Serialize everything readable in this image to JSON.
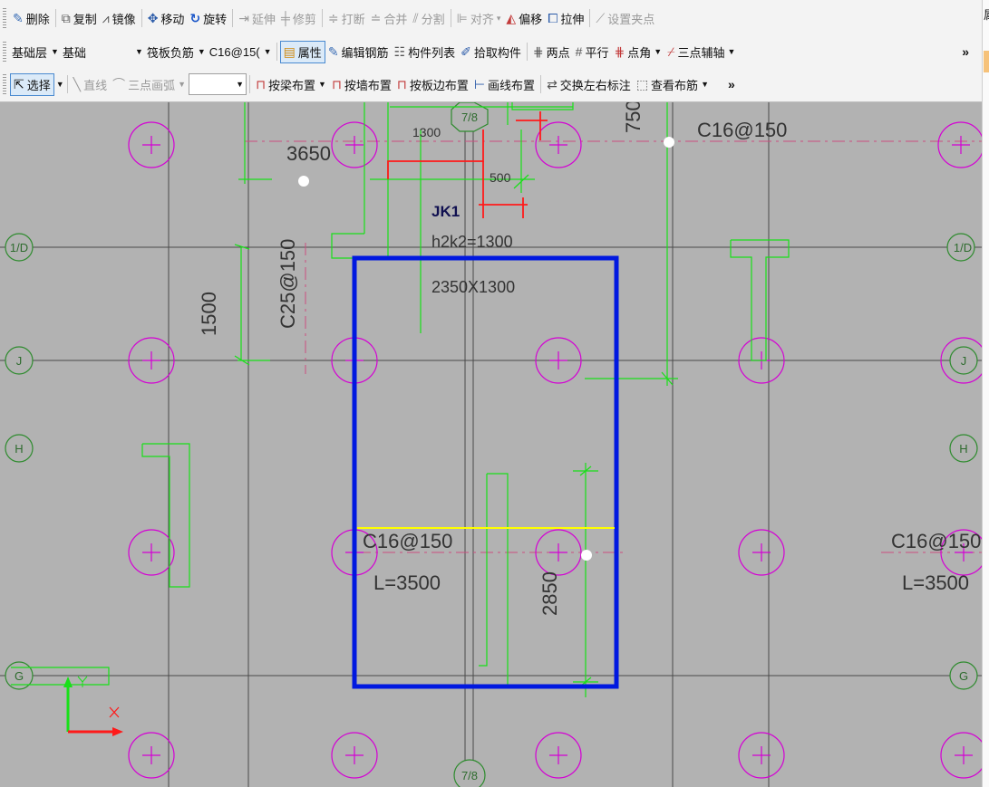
{
  "toolbar1": {
    "delete": "删除",
    "copy": "复制",
    "mirror": "镜像",
    "move": "移动",
    "rotate": "旋转",
    "extend": "延伸",
    "trim": "修剪",
    "break": "打断",
    "merge": "合并",
    "split": "分割",
    "align": "对齐",
    "offset": "偏移",
    "stretch": "拉伸",
    "set_grip": "设置夹点"
  },
  "toolbar2": {
    "layer": "基础层",
    "category": "基础",
    "component_type": "筏板负筋",
    "component": "C16@15(",
    "properties": "属性",
    "edit_rebar": "编辑钢筋",
    "component_list": "构件列表",
    "pick": "拾取构件",
    "two_points": "两点",
    "parallel": "平行",
    "point_angle": "点角",
    "three_point_axis": "三点辅轴"
  },
  "toolbar3": {
    "select": "选择",
    "line": "直线",
    "arc": "三点画弧",
    "by_beam": "按梁布置",
    "by_wall": "按墙布置",
    "by_slab_edge": "按板边布置",
    "by_line": "画线布置",
    "swap_labels": "交换左右标注",
    "view_rebar": "查看布筋"
  },
  "more_glyph": "»",
  "right_panel_text": "属",
  "colors": {
    "canvas_bg": "#b2b2b2",
    "axis": "#4a4a4a",
    "grid_bubble": "#2e8b2e",
    "column_circle": "#d400d4",
    "rebar_green": "#18e018",
    "rebar_red": "#ff1a1a",
    "selection_blue": "#0018e0",
    "highlight_yellow": "#ffff00",
    "dash_line": "#cc4d80",
    "label_dark": "#333333",
    "label_blue": "#101050"
  },
  "drawing": {
    "axis_bubbles": {
      "top": "7/8",
      "bottom": "7/8",
      "row_1D": "1/D",
      "row_J": "J",
      "row_H": "H",
      "row_G": "G"
    },
    "labels": {
      "dim_1300": "1300",
      "dim_3650": "3650",
      "dim_500": "500",
      "dim_750": "750",
      "rebar_top_right": "C16@150",
      "jk_name": "JK1",
      "jk_height": "h2k2=1300",
      "jk_size": "2350X1300",
      "dim_1500": "1500",
      "rebar_c25": "C25@150",
      "rebar_center": "C16@150",
      "len_center": "L=3500",
      "dim_2850": "2850",
      "rebar_right": "C16@150",
      "len_right": "L=3500"
    }
  }
}
